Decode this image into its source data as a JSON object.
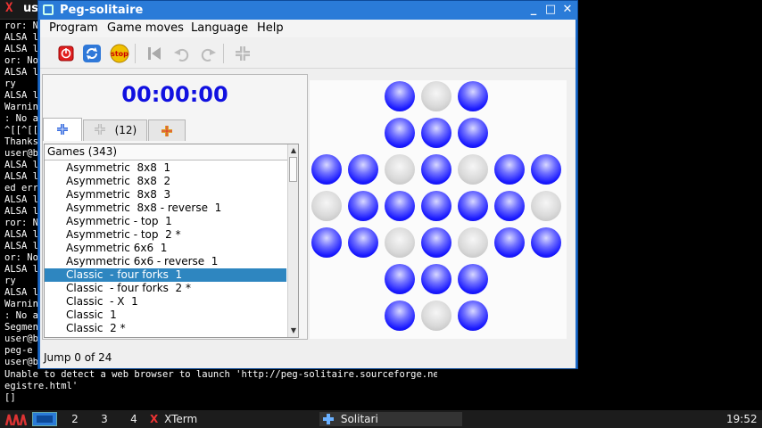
{
  "terminal": {
    "title": "us",
    "lines": [
      "ror: N",
      "ALSA l",
      "ALSA l",
      "or: No",
      "ALSA l",
      "ry",
      "ALSA l",
      "Warnin",
      ": No a",
      "^[[^[[",
      "Thanks",
      "user@b",
      "ALSA l",
      "ALSA l",
      "ed err",
      "ALSA l",
      "ALSA l",
      "ror: N",
      "ALSA l",
      "ALSA l",
      "or: No",
      "ALSA l",
      "ry",
      "ALSA l",
      "Warnin",
      ": No a",
      "Segmen",
      "user@b",
      "peg-e",
      "user@b"
    ],
    "bottom_lines": [
      "Unable to detect a web browser to launch 'http://peg-solitaire.sourceforge.net/r",
      "egistre.html'",
      "[]"
    ]
  },
  "window": {
    "title": "Peg-solitaire",
    "controls": [
      "_",
      "□",
      "✕"
    ]
  },
  "menu": [
    "Program",
    "Game moves",
    "Language",
    "Help"
  ],
  "timer": "00:00:00",
  "tabs": [
    {
      "icon": "board-icon",
      "label": ""
    },
    {
      "icon": "board-gray-icon",
      "label": "(12)"
    },
    {
      "icon": "board-color-icon",
      "label": ""
    }
  ],
  "games_header": "Games (343)",
  "games": [
    "Asymmetric  8x8  1",
    "Asymmetric  8x8  2",
    "Asymmetric  8x8  3",
    "Asymmetric  8x8 - reverse  1",
    "Asymmetric - top  1",
    "Asymmetric - top  2 *",
    "Asymmetric 6x6  1",
    "Asymmetric 6x6 - reverse  1",
    "Classic  - four forks  1",
    "Classic  - four forks  2 *",
    "Classic  - X  1",
    "Classic  1",
    "Classic  2 *"
  ],
  "selected_index": 8,
  "board": [
    [
      null,
      null,
      1,
      0,
      1,
      null,
      null
    ],
    [
      null,
      null,
      1,
      1,
      1,
      null,
      null
    ],
    [
      1,
      1,
      0,
      1,
      0,
      1,
      1
    ],
    [
      0,
      1,
      1,
      1,
      1,
      1,
      0
    ],
    [
      1,
      1,
      0,
      1,
      0,
      1,
      1
    ],
    [
      null,
      null,
      1,
      1,
      1,
      null,
      null
    ],
    [
      null,
      null,
      1,
      0,
      1,
      null,
      null
    ]
  ],
  "status": "Jump 0 of 24",
  "taskbar": {
    "workspaces": [
      "2",
      "3",
      "4"
    ],
    "tasks": [
      "XTerm",
      "Solitari"
    ],
    "clock": "19:52"
  },
  "colors": {
    "accent": "#2a7bd8",
    "peg": "#1a1aff",
    "timer": "#1010e0",
    "selection": "#2e86c0"
  }
}
